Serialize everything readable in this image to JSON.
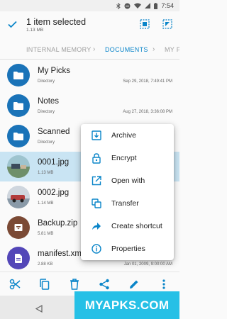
{
  "status_bar": {
    "time": "7:54"
  },
  "app_bar": {
    "title": "1 item selected",
    "subtitle": "1.13 MB"
  },
  "breadcrumb": {
    "items": [
      "INTERNAL MEMORY",
      "DOCUMENTS",
      "MY P"
    ]
  },
  "files": [
    {
      "name": "My Picks",
      "meta": "Directory",
      "date": "Sep 29, 2018, 7:49:41 PM",
      "icon": "folder-icon"
    },
    {
      "name": "Notes",
      "meta": "Directory",
      "date": "Aug 27, 2018, 3:36:08 PM",
      "icon": "folder-icon"
    },
    {
      "name": "Scanned",
      "meta": "Directory",
      "date": "",
      "icon": "folder-icon"
    },
    {
      "name": "0001.jpg",
      "meta": "1.13 MB",
      "date": "",
      "icon": "image-thumbnail",
      "selected": true
    },
    {
      "name": "0002.jpg",
      "meta": "1.14 MB",
      "date": "",
      "icon": "image-thumbnail"
    },
    {
      "name": "Backup.zip",
      "meta": "5.81 MB",
      "date": "",
      "icon": "archive-icon"
    },
    {
      "name": "manifest.xml",
      "meta": "2.88 KB",
      "date": "Jan 01, 2009, 9:00:00 AM",
      "icon": "document-icon"
    }
  ],
  "context_menu": {
    "items": [
      {
        "label": "Archive",
        "icon": "archive-icon"
      },
      {
        "label": "Encrypt",
        "icon": "lock-icon"
      },
      {
        "label": "Open with",
        "icon": "open-external-icon"
      },
      {
        "label": "Transfer",
        "icon": "transfer-icon"
      },
      {
        "label": "Create shortcut",
        "icon": "shortcut-icon"
      },
      {
        "label": "Properties",
        "icon": "info-icon"
      }
    ]
  },
  "toolbar": {
    "actions": [
      "cut-icon",
      "copy-icon",
      "delete-icon",
      "share-icon",
      "edit-icon",
      "more-icon"
    ]
  },
  "watermark": "MYAPKS.COM",
  "colors": {
    "accent": "#0a85c9",
    "folder": "#1a73b8",
    "selected_row": "#c9e4f3",
    "watermark": "#26c0e6"
  }
}
